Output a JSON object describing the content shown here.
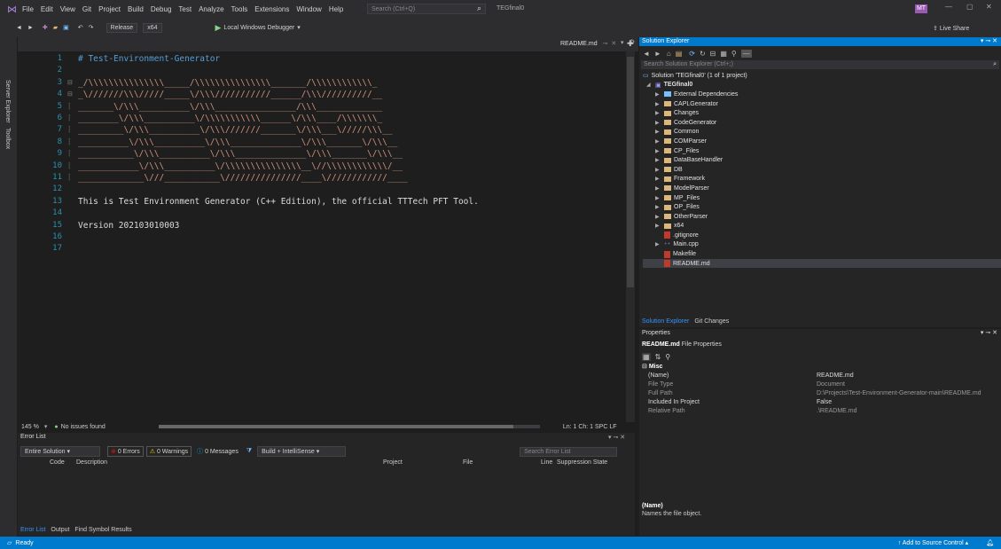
{
  "app": {
    "menu": [
      "File",
      "Edit",
      "View",
      "Git",
      "Project",
      "Build",
      "Debug",
      "Test",
      "Analyze",
      "Tools",
      "Extensions",
      "Window",
      "Help"
    ],
    "search_placeholder": "Search (Ctrl+Q)",
    "solution_title": "TEGfinal0",
    "user_initials": "MT",
    "live_share": "Live Share"
  },
  "toolbar": {
    "config": "Release",
    "platform": "x64",
    "debugger": "Local Windows Debugger"
  },
  "side_tabs": [
    "Server Explorer",
    "Toolbox"
  ],
  "editor": {
    "tab_name": "README.md",
    "line_numbers": [
      "1",
      "2",
      "3",
      "4",
      "5",
      "6",
      "7",
      "8",
      "9",
      "10",
      "11",
      "12",
      "13",
      "14",
      "15",
      "16",
      "17"
    ],
    "heading": "# Test-Environment-Generator",
    "art": [
      "_/\\\\\\\\\\\\\\\\\\\\\\\\\\\\\\_____/\\\\\\\\\\\\\\\\\\\\\\\\\\\\\\_______/\\\\\\\\\\\\\\\\\\\\\\\\_",
      "_\\///////\\\\\\/////_____\\/\\\\\\///////////______/\\\\\\//////////__",
      "_______\\/\\\\\\__________\\/\\\\\\________________/\\\\\\_____________",
      "________\\/\\\\\\__________\\/\\\\\\\\\\\\\\\\\\\\\\______\\/\\\\\\____/\\\\\\\\\\\\\\_",
      "_________\\/\\\\\\__________\\/\\\\\\///////_______\\/\\\\\\___\\/////\\\\\\__",
      "__________\\/\\\\\\__________\\/\\\\\\______________\\/\\\\\\_______\\/\\\\\\__",
      "___________\\/\\\\\\__________\\/\\\\\\______________\\/\\\\\\_______\\/\\\\\\__",
      "____________\\/\\\\\\__________\\/\\\\\\\\\\\\\\\\\\\\\\\\\\\\\\__\\//\\\\\\\\\\\\\\\\\\\\\\\\/__",
      "_____________\\///___________\\///////////////____\\////////////____"
    ],
    "description": "This is Test Environment Generator (C++ Edition), the official TTTech PFT Tool.",
    "version": "Version 202103010003",
    "zoom": "145 %",
    "issues": "No issues found",
    "position": "Ln: 1   Ch: 1   SPC   LF"
  },
  "error_list": {
    "title": "Error List",
    "scope": "Entire Solution",
    "errors": "0 Errors",
    "warnings": "0 Warnings",
    "messages": "0 Messages",
    "build_filter": "Build + IntelliSense",
    "search_placeholder": "Search Error List",
    "columns": [
      "Code",
      "Description",
      "Project",
      "File",
      "Line",
      "Suppression State"
    ],
    "bottom_tabs": [
      "Error List",
      "Output",
      "Find Symbol Results"
    ]
  },
  "solution_explorer": {
    "title": "Solution Explorer",
    "search_placeholder": "Search Solution Explorer (Ctrl+;)",
    "solution_line": "Solution 'TEGfinal0' (1 of 1 project)",
    "project": "TEGfinal0",
    "items": [
      {
        "label": "External Dependencies",
        "kind": "dep"
      },
      {
        "label": "CAPLGenerator",
        "kind": "folder"
      },
      {
        "label": "Changes",
        "kind": "folder"
      },
      {
        "label": "CodeGenerator",
        "kind": "folder"
      },
      {
        "label": "Common",
        "kind": "folder"
      },
      {
        "label": "COMParser",
        "kind": "folder"
      },
      {
        "label": "CP_Files",
        "kind": "folder"
      },
      {
        "label": "DataBaseHandler",
        "kind": "folder"
      },
      {
        "label": "DB",
        "kind": "folder"
      },
      {
        "label": "Framework",
        "kind": "folder"
      },
      {
        "label": "ModelParser",
        "kind": "folder"
      },
      {
        "label": "MP_Files",
        "kind": "folder"
      },
      {
        "label": "OP_Files",
        "kind": "folder"
      },
      {
        "label": "OtherParser",
        "kind": "folder"
      },
      {
        "label": "x64",
        "kind": "folder"
      },
      {
        "label": ".gitignore",
        "kind": "file"
      },
      {
        "label": "Main.cpp",
        "kind": "cpp"
      },
      {
        "label": "Makefile",
        "kind": "file"
      },
      {
        "label": "README.md",
        "kind": "file"
      }
    ],
    "bottom_tabs": [
      "Solution Explorer",
      "Git Changes"
    ]
  },
  "properties": {
    "title": "Properties",
    "subject": "README.md",
    "subject_suffix": "File Properties",
    "category": "Misc",
    "rows": [
      {
        "k": "(Name)",
        "v": "README.md"
      },
      {
        "k": "File Type",
        "v": "Document"
      },
      {
        "k": "Full Path",
        "v": "D:\\Projects\\Test-Environment-Generator-main\\README.md"
      },
      {
        "k": "Included In Project",
        "v": "False"
      },
      {
        "k": "Relative Path",
        "v": ".\\README.md"
      }
    ],
    "desc_title": "(Name)",
    "desc_text": "Names the file object."
  },
  "status": {
    "left": "Ready",
    "right": "Add to Source Control"
  },
  "colors": {
    "accent": "#007acc",
    "heading": "#569cd6",
    "art": "#ce9178"
  }
}
